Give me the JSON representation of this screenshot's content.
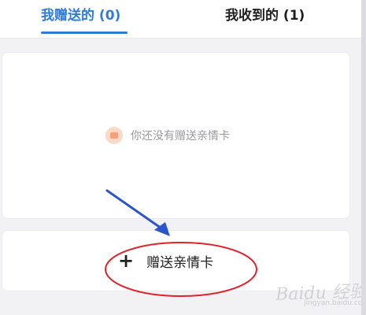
{
  "tabs": {
    "sent": "我赠送的 (0)",
    "received": "我收到的 (1)"
  },
  "empty_state": {
    "text": "你还没有赠送亲情卡",
    "icon": "card-icon"
  },
  "gift_button": {
    "plus": "+",
    "label": "赠送亲情卡"
  },
  "watermark": {
    "text": "Baidu 经验",
    "sub": "jingyan.baidu.com"
  },
  "colors": {
    "accent": "#2f7bd8",
    "annotation_arrow": "#2b56c9",
    "annotation_ellipse": "#e0222a"
  }
}
